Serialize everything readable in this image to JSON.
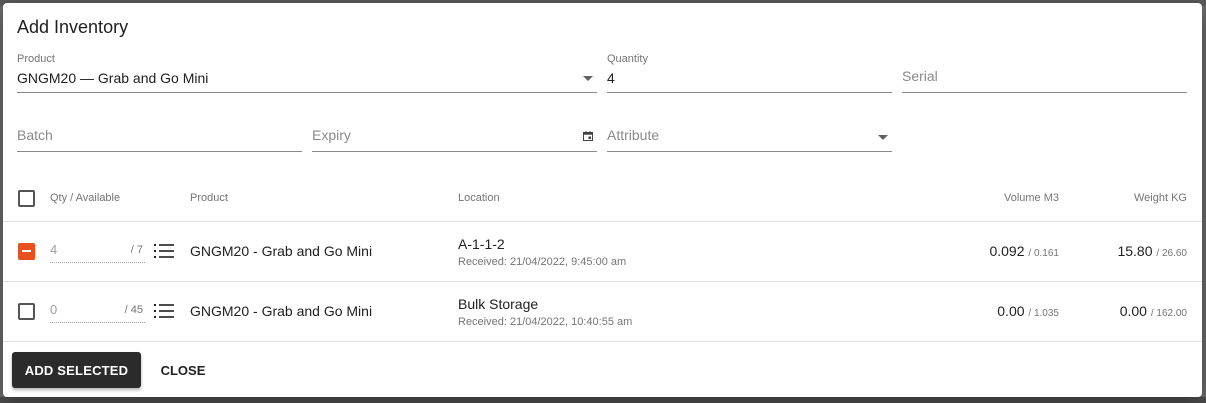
{
  "dialog": {
    "title": "Add Inventory",
    "fields": {
      "product": {
        "label": "Product",
        "value": "GNGM20 — Grab and Go Mini"
      },
      "quantity": {
        "label": "Quantity",
        "value": "4"
      },
      "serial": {
        "placeholder": "Serial"
      },
      "batch": {
        "placeholder": "Batch"
      },
      "expiry": {
        "placeholder": "Expiry"
      },
      "attribute": {
        "placeholder": "Attribute"
      }
    },
    "table": {
      "headers": {
        "qty": "Qty / Available",
        "product": "Product",
        "location": "Location",
        "volume": "Volume M3",
        "weight": "Weight KG"
      },
      "rows": [
        {
          "qty": "4",
          "available": "/ 7",
          "product": "GNGM20 - Grab and Go Mini",
          "location": "A-1-1-2",
          "received": "Received: 21/04/2022, 9:45:00 am",
          "volume": "0.092",
          "volume_total": "/ 0.161",
          "weight": "15.80",
          "weight_total": "/ 26.60",
          "checkbox_state": "indeterminate"
        },
        {
          "qty": "0",
          "available": "/ 45",
          "product": "GNGM20 - Grab and Go Mini",
          "location": "Bulk Storage",
          "received": "Received: 21/04/2022, 10:40:55 am",
          "volume": "0.00",
          "volume_total": "/ 1.035",
          "weight": "0.00",
          "weight_total": "/ 162.00",
          "checkbox_state": "unchecked"
        }
      ]
    },
    "actions": {
      "add_selected": "ADD SELECTED",
      "close": "CLOSE"
    }
  },
  "colors": {
    "accent": "#e8501d",
    "primary_button": "#2b2b2b"
  }
}
